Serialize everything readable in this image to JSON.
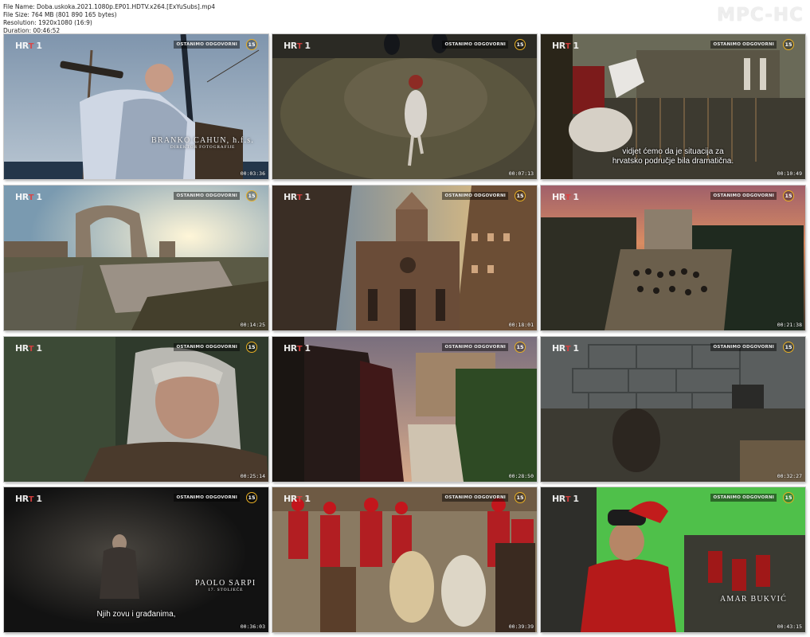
{
  "header": {
    "file_name": "File Name: Doba.uskoka.2021.1080p.EP01.HDTV.x264.[ExYuSubs].mp4",
    "file_size": "File Size: 764 MB (801 890 165 bytes)",
    "resolution": "Resolution: 1920x1080 (16:9)",
    "duration": "Duration: 00:46:52",
    "brand": "MPC-HC"
  },
  "overlay": {
    "channel_prefix": "HR",
    "channel_x": "T",
    "channel_num": "1",
    "ostanimo": "OSTANIMO ODGOVORNI",
    "age": "15"
  },
  "thumbnails": [
    {
      "timestamp": "00:03:36",
      "credit_name": "BRANKO CAHUN, h.f.s.",
      "credit_role": "DIREKTOR FOTOGRAFIJE"
    },
    {
      "timestamp": "00:07:13"
    },
    {
      "timestamp": "00:10:49",
      "subtitle1": "vidjet ćemo da je situacija za",
      "subtitle2": "hrvatsko područje bila dramatična."
    },
    {
      "timestamp": "00:14:25"
    },
    {
      "timestamp": "00:18:01"
    },
    {
      "timestamp": "00:21:38"
    },
    {
      "timestamp": "00:25:14"
    },
    {
      "timestamp": "00:28:50"
    },
    {
      "timestamp": "00:32:27"
    },
    {
      "timestamp": "00:36:03",
      "subtitle1": "Njih zovu i građanima,",
      "credit_name": "PAOLO SARPI",
      "credit_role": "17. STOLJEĆE"
    },
    {
      "timestamp": "00:39:39"
    },
    {
      "timestamp": "00:43:15",
      "credit_name": "AMAR BUKVIĆ"
    }
  ]
}
